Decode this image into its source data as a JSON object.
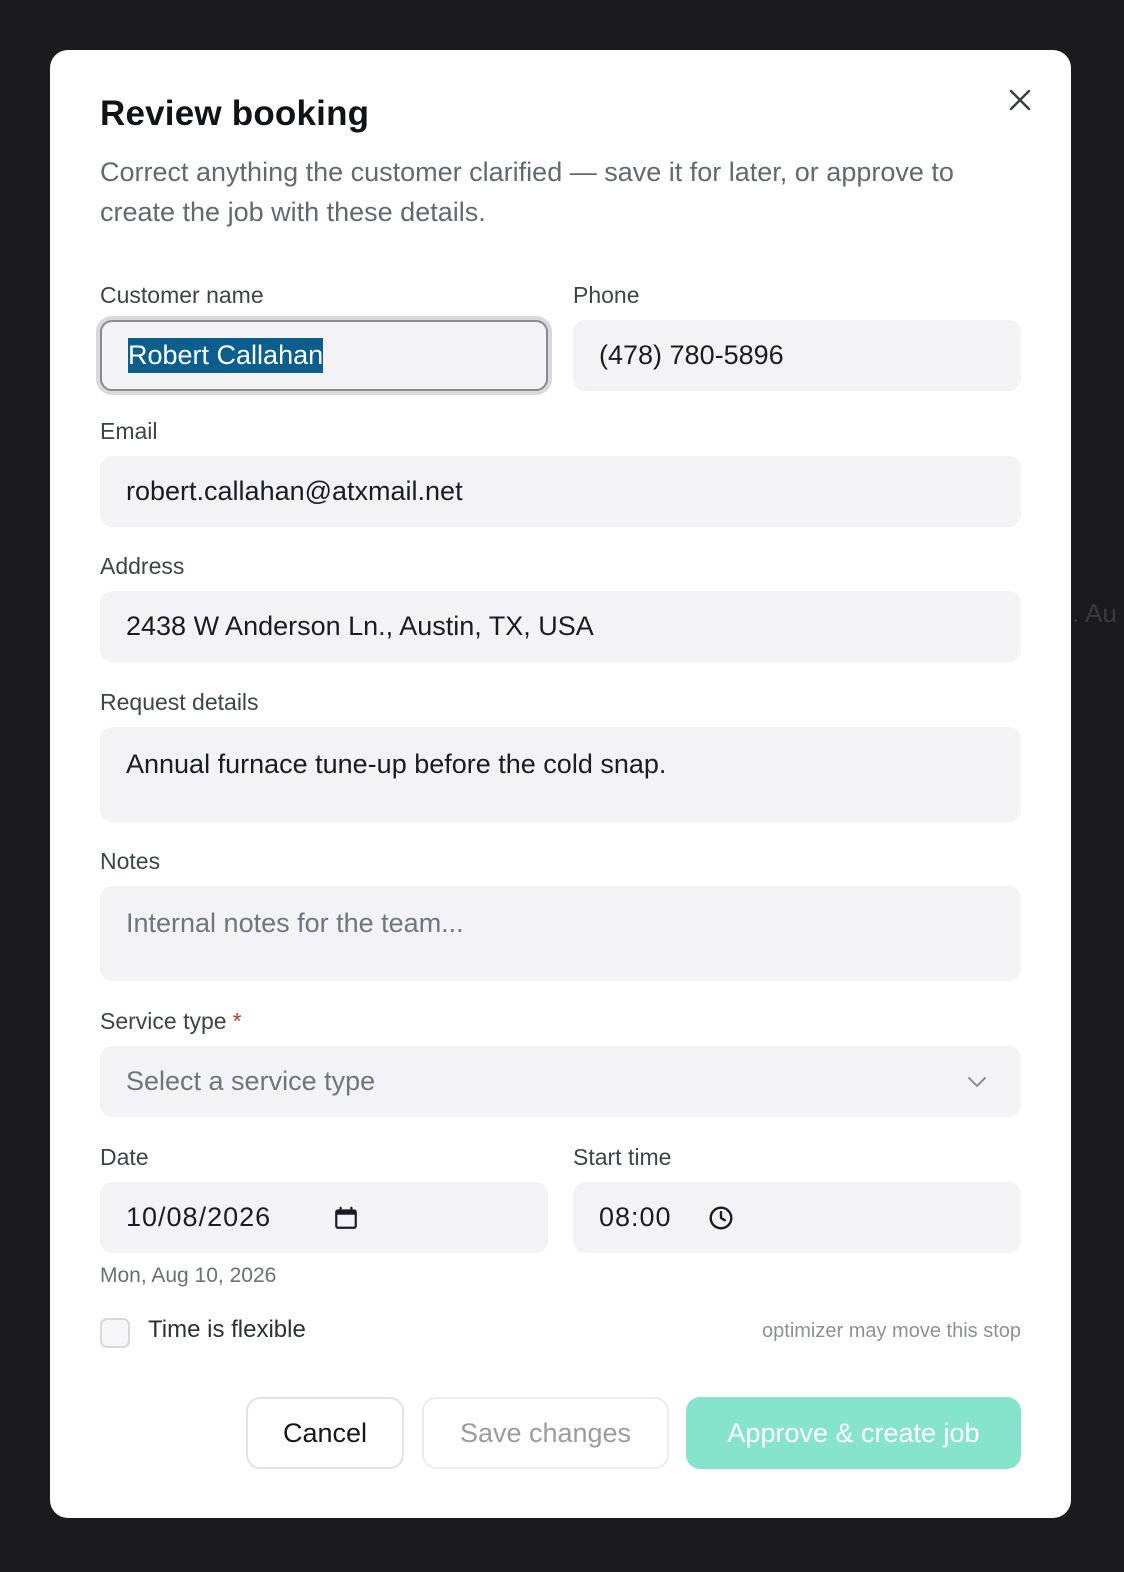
{
  "backdrop": {
    "text": ". Au"
  },
  "modal": {
    "title": "Review booking",
    "subtitle": "Correct anything the customer clarified — save it for later, or approve to create the job with these details.",
    "close_icon": "close-icon"
  },
  "form": {
    "customer_name": {
      "label": "Customer name",
      "value": "Robert Callahan",
      "state": "focused, text selected"
    },
    "phone": {
      "label": "Phone",
      "value": "(478) 780-5896"
    },
    "email": {
      "label": "Email",
      "value": "robert.callahan@atxmail.net"
    },
    "address": {
      "label": "Address",
      "value": "2438 W Anderson Ln., Austin, TX, USA"
    },
    "request_details": {
      "label": "Request details",
      "value": "Annual furnace tune-up before the cold snap."
    },
    "notes": {
      "label": "Notes",
      "placeholder": "Internal notes for the team...",
      "value": ""
    },
    "service_type": {
      "label": "Service type",
      "required_marker": "*",
      "placeholder": "Select a service type",
      "icon": "chevron-down-icon"
    },
    "date": {
      "label": "Date",
      "value": "10/08/2026",
      "hint": "Mon, Aug 10, 2026",
      "icon": "calendar-icon"
    },
    "start_time": {
      "label": "Start time",
      "value": "08:00",
      "icon": "clock-icon"
    },
    "time_flexible": {
      "label": "Time is flexible",
      "checked": false,
      "hint": "optimizer may move this stop"
    }
  },
  "actions": {
    "cancel_label": "Cancel",
    "save_label": "Save changes",
    "approve_label": "Approve & create job"
  },
  "colors": {
    "overlay": "#1b1b1d",
    "modal_bg": "#ffffff",
    "field_bg": "#f3f3f5",
    "selection": "#0c5f8d",
    "required": "#c0392b",
    "approve_button": "#86e4cc"
  }
}
